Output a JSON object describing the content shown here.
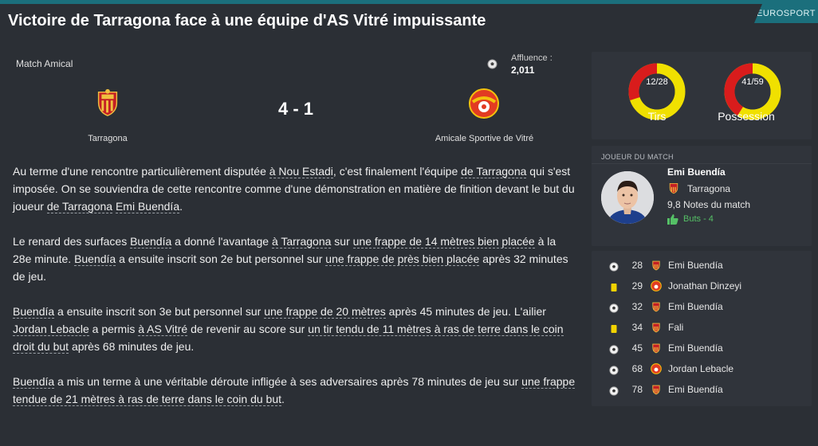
{
  "header": {
    "headline": "Victoire de Tarragona face à une équipe d'AS Vitré impuissante",
    "source_badge": "EUROSPORT",
    "accent_color": "#1b6f7c"
  },
  "match": {
    "competition": "Match Amical",
    "attendance_label": "Affluence :",
    "attendance_value": "2,011",
    "score": "4 - 1",
    "home_team": "Tarragona",
    "away_team": "Amicale Sportive de Vitré",
    "home_crest_icon": "tarragona-crest-icon",
    "away_crest_icon": "vitre-crest-icon"
  },
  "article": {
    "paragraphs": [
      [
        {
          "t": "Au terme d'une rencontre particulièrement disputée "
        },
        {
          "t": "à Nou Estadi",
          "link": true
        },
        {
          "t": ", c'est finalement l'équipe "
        },
        {
          "t": "de Tarragona",
          "link": true
        },
        {
          "t": " qui s'est imposée. On se souviendra de cette rencontre comme d'une démonstration en matière de finition devant le but du joueur "
        },
        {
          "t": "de Tarragona",
          "link": true
        },
        {
          "t": " "
        },
        {
          "t": "Emi Buendía",
          "link": true
        },
        {
          "t": "."
        }
      ],
      [
        {
          "t": "Le renard des surfaces "
        },
        {
          "t": "Buendía",
          "link": true
        },
        {
          "t": " a donné l'avantage "
        },
        {
          "t": "à Tarragona",
          "link": true
        },
        {
          "t": " sur "
        },
        {
          "t": "une frappe de 14 mètres bien placée",
          "link": true
        },
        {
          "t": " à la 28e minute. "
        },
        {
          "t": "Buendía",
          "link": true
        },
        {
          "t": " a ensuite inscrit son 2e but personnel sur "
        },
        {
          "t": "une frappe de près bien placée",
          "link": true
        },
        {
          "t": " après 32 minutes de jeu."
        }
      ],
      [
        {
          "t": "Buendía",
          "link": true
        },
        {
          "t": " a ensuite inscrit son 3e but personnel sur "
        },
        {
          "t": "une frappe de 20 mètres",
          "link": true
        },
        {
          "t": " après 45 minutes de jeu. L'ailier "
        },
        {
          "t": "Jordan Lebacle",
          "link": true
        },
        {
          "t": " a permis "
        },
        {
          "t": "à AS Vitré",
          "link": true
        },
        {
          "t": " de revenir au score sur "
        },
        {
          "t": "un tir tendu de 11 mètres à ras de terre dans le coin droit du but",
          "link": true
        },
        {
          "t": " après 68 minutes de jeu."
        }
      ],
      [
        {
          "t": "Buendía",
          "link": true
        },
        {
          "t": " a mis un terme à une véritable déroute infligée à ses adversaires après 78 minutes de jeu sur "
        },
        {
          "t": "une frappe tendue de 21 mètres à ras de terre dans le coin du but",
          "link": true
        },
        {
          "t": "."
        }
      ]
    ]
  },
  "stats": {
    "shots": {
      "home": 12,
      "away": 28,
      "label": "12/28",
      "caption": "Tirs"
    },
    "possession": {
      "home": 41,
      "away": 59,
      "label": "41/59",
      "caption": "Possession"
    },
    "home_color": "#d91c1c",
    "away_color": "#f0e000"
  },
  "player_of_match": {
    "title": "JOUEUR DU MATCH",
    "name": "Emi Buendía",
    "club": "Tarragona",
    "rating": "9,8 Notes du match",
    "goals": "Buts - 4",
    "goals_color": "#55c066"
  },
  "events": [
    {
      "type": "goal",
      "icon": "ball-icon",
      "minute": "28",
      "team": "home",
      "player": "Emi Buendía"
    },
    {
      "type": "yellow-card",
      "icon": "yellow-card-icon",
      "minute": "29",
      "team": "away",
      "player": "Jonathan Dinzeyi"
    },
    {
      "type": "goal",
      "icon": "ball-icon",
      "minute": "32",
      "team": "home",
      "player": "Emi Buendía"
    },
    {
      "type": "yellow-card",
      "icon": "yellow-card-icon",
      "minute": "34",
      "team": "home",
      "player": "Fali"
    },
    {
      "type": "goal",
      "icon": "ball-icon",
      "minute": "45",
      "team": "home",
      "player": "Emi Buendía"
    },
    {
      "type": "goal",
      "icon": "ball-icon",
      "minute": "68",
      "team": "away",
      "player": "Jordan Lebacle"
    },
    {
      "type": "goal",
      "icon": "ball-icon",
      "minute": "78",
      "team": "home",
      "player": "Emi Buendía"
    }
  ]
}
